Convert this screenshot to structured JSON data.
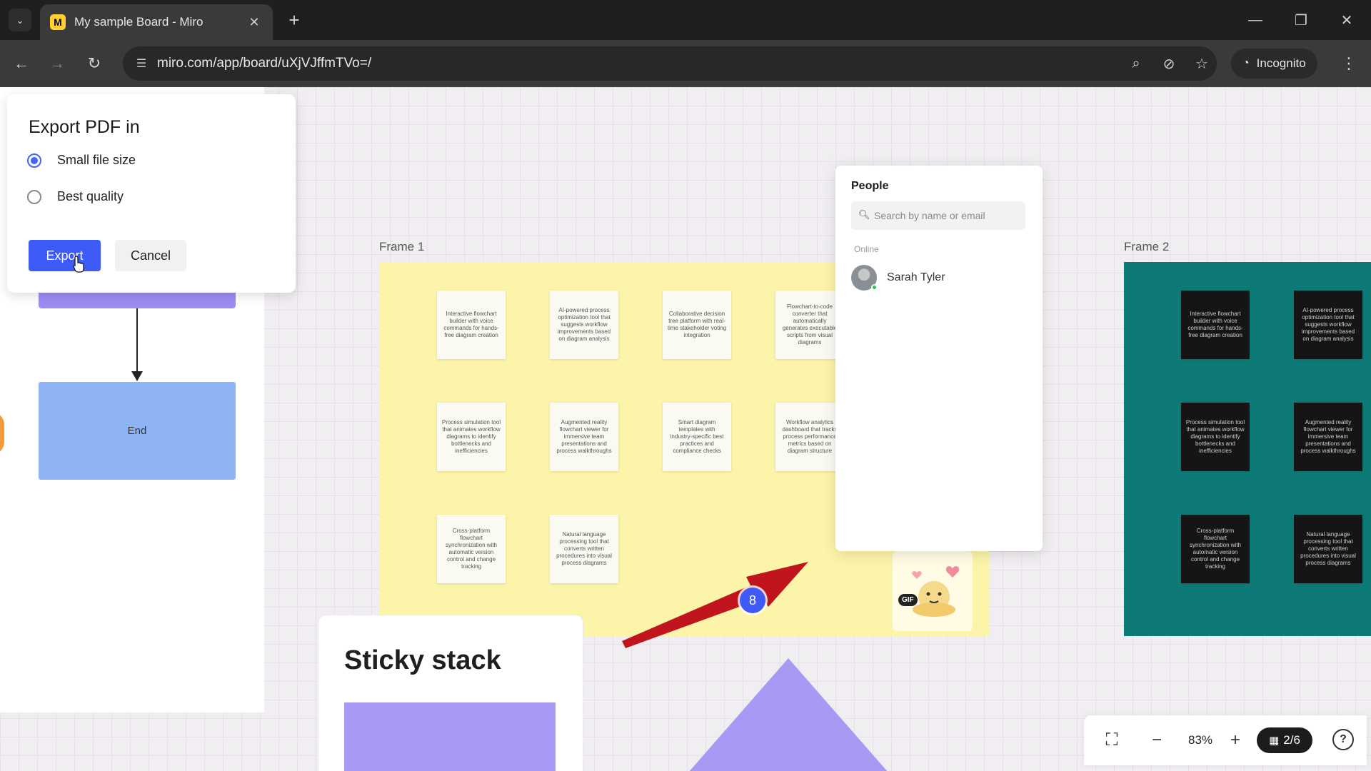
{
  "browser": {
    "tab_title": "My sample Board - Miro",
    "favicon_letter": "M",
    "url": "miro.com/app/board/uXjVJffmTVo=/",
    "incognito_label": "Incognito"
  },
  "export_dialog": {
    "title": "Export PDF in",
    "options": [
      {
        "label": "Small file size",
        "checked": true
      },
      {
        "label": "Best quality",
        "checked": false
      }
    ],
    "export_label": "Export",
    "cancel_label": "Cancel"
  },
  "flowchart": {
    "end_label": "End"
  },
  "frames": {
    "frame1": {
      "label": "Frame 1",
      "notes": [
        "Interactive flowchart builder with voice commands for hands-free diagram creation",
        "AI-powered process optimization tool that suggests workflow improvements based on diagram analysis",
        "Collaborative decision tree platform with real-time stakeholder voting integration",
        "Flowchart-to-code converter that automatically generates executable scripts from visual diagrams",
        "Process simulation tool that animates workflow diagrams to identify bottlenecks and inefficiencies",
        "Augmented reality flowchart viewer for immersive team presentations and process walkthroughs",
        "Smart diagram templates with industry-specific best practices and compliance checks",
        "Workflow analytics dashboard that tracks process performance metrics based on diagram structure",
        "Cross-platform flowchart synchronization with automatic version control and change tracking",
        "Natural language processing tool that converts written procedures into visual process diagrams"
      ]
    },
    "frame2": {
      "label": "Frame 2",
      "notes": [
        "Interactive flowchart builder with voice commands for hands-free diagram creation",
        "AI-powered process optimization tool that suggests workflow improvements based on diagram analysis",
        "Process simulation tool that animates workflow diagrams to identify bottlenecks and inefficiencies",
        "Augmented reality flowchart viewer for immersive team presentations and process walkthroughs",
        "Cross-platform flowchart synchronization with automatic version control and change tracking",
        "Natural language processing tool that converts written procedures into visual process diagrams"
      ]
    }
  },
  "people_panel": {
    "title": "People",
    "search_placeholder": "Search by name or email",
    "online_label": "Online",
    "people": [
      {
        "name": "Sarah Tyler"
      }
    ]
  },
  "badge_count": "8",
  "gif_label": "GIF",
  "sticky_stack_title": "Sticky stack",
  "zoom": {
    "level": "83%",
    "pages": "2/6"
  },
  "colors": {
    "accent": "#3f5bf7",
    "frame1_bg": "#fcf4a8",
    "frame2_bg": "#0e7a77",
    "arrow": "#c0151d"
  }
}
